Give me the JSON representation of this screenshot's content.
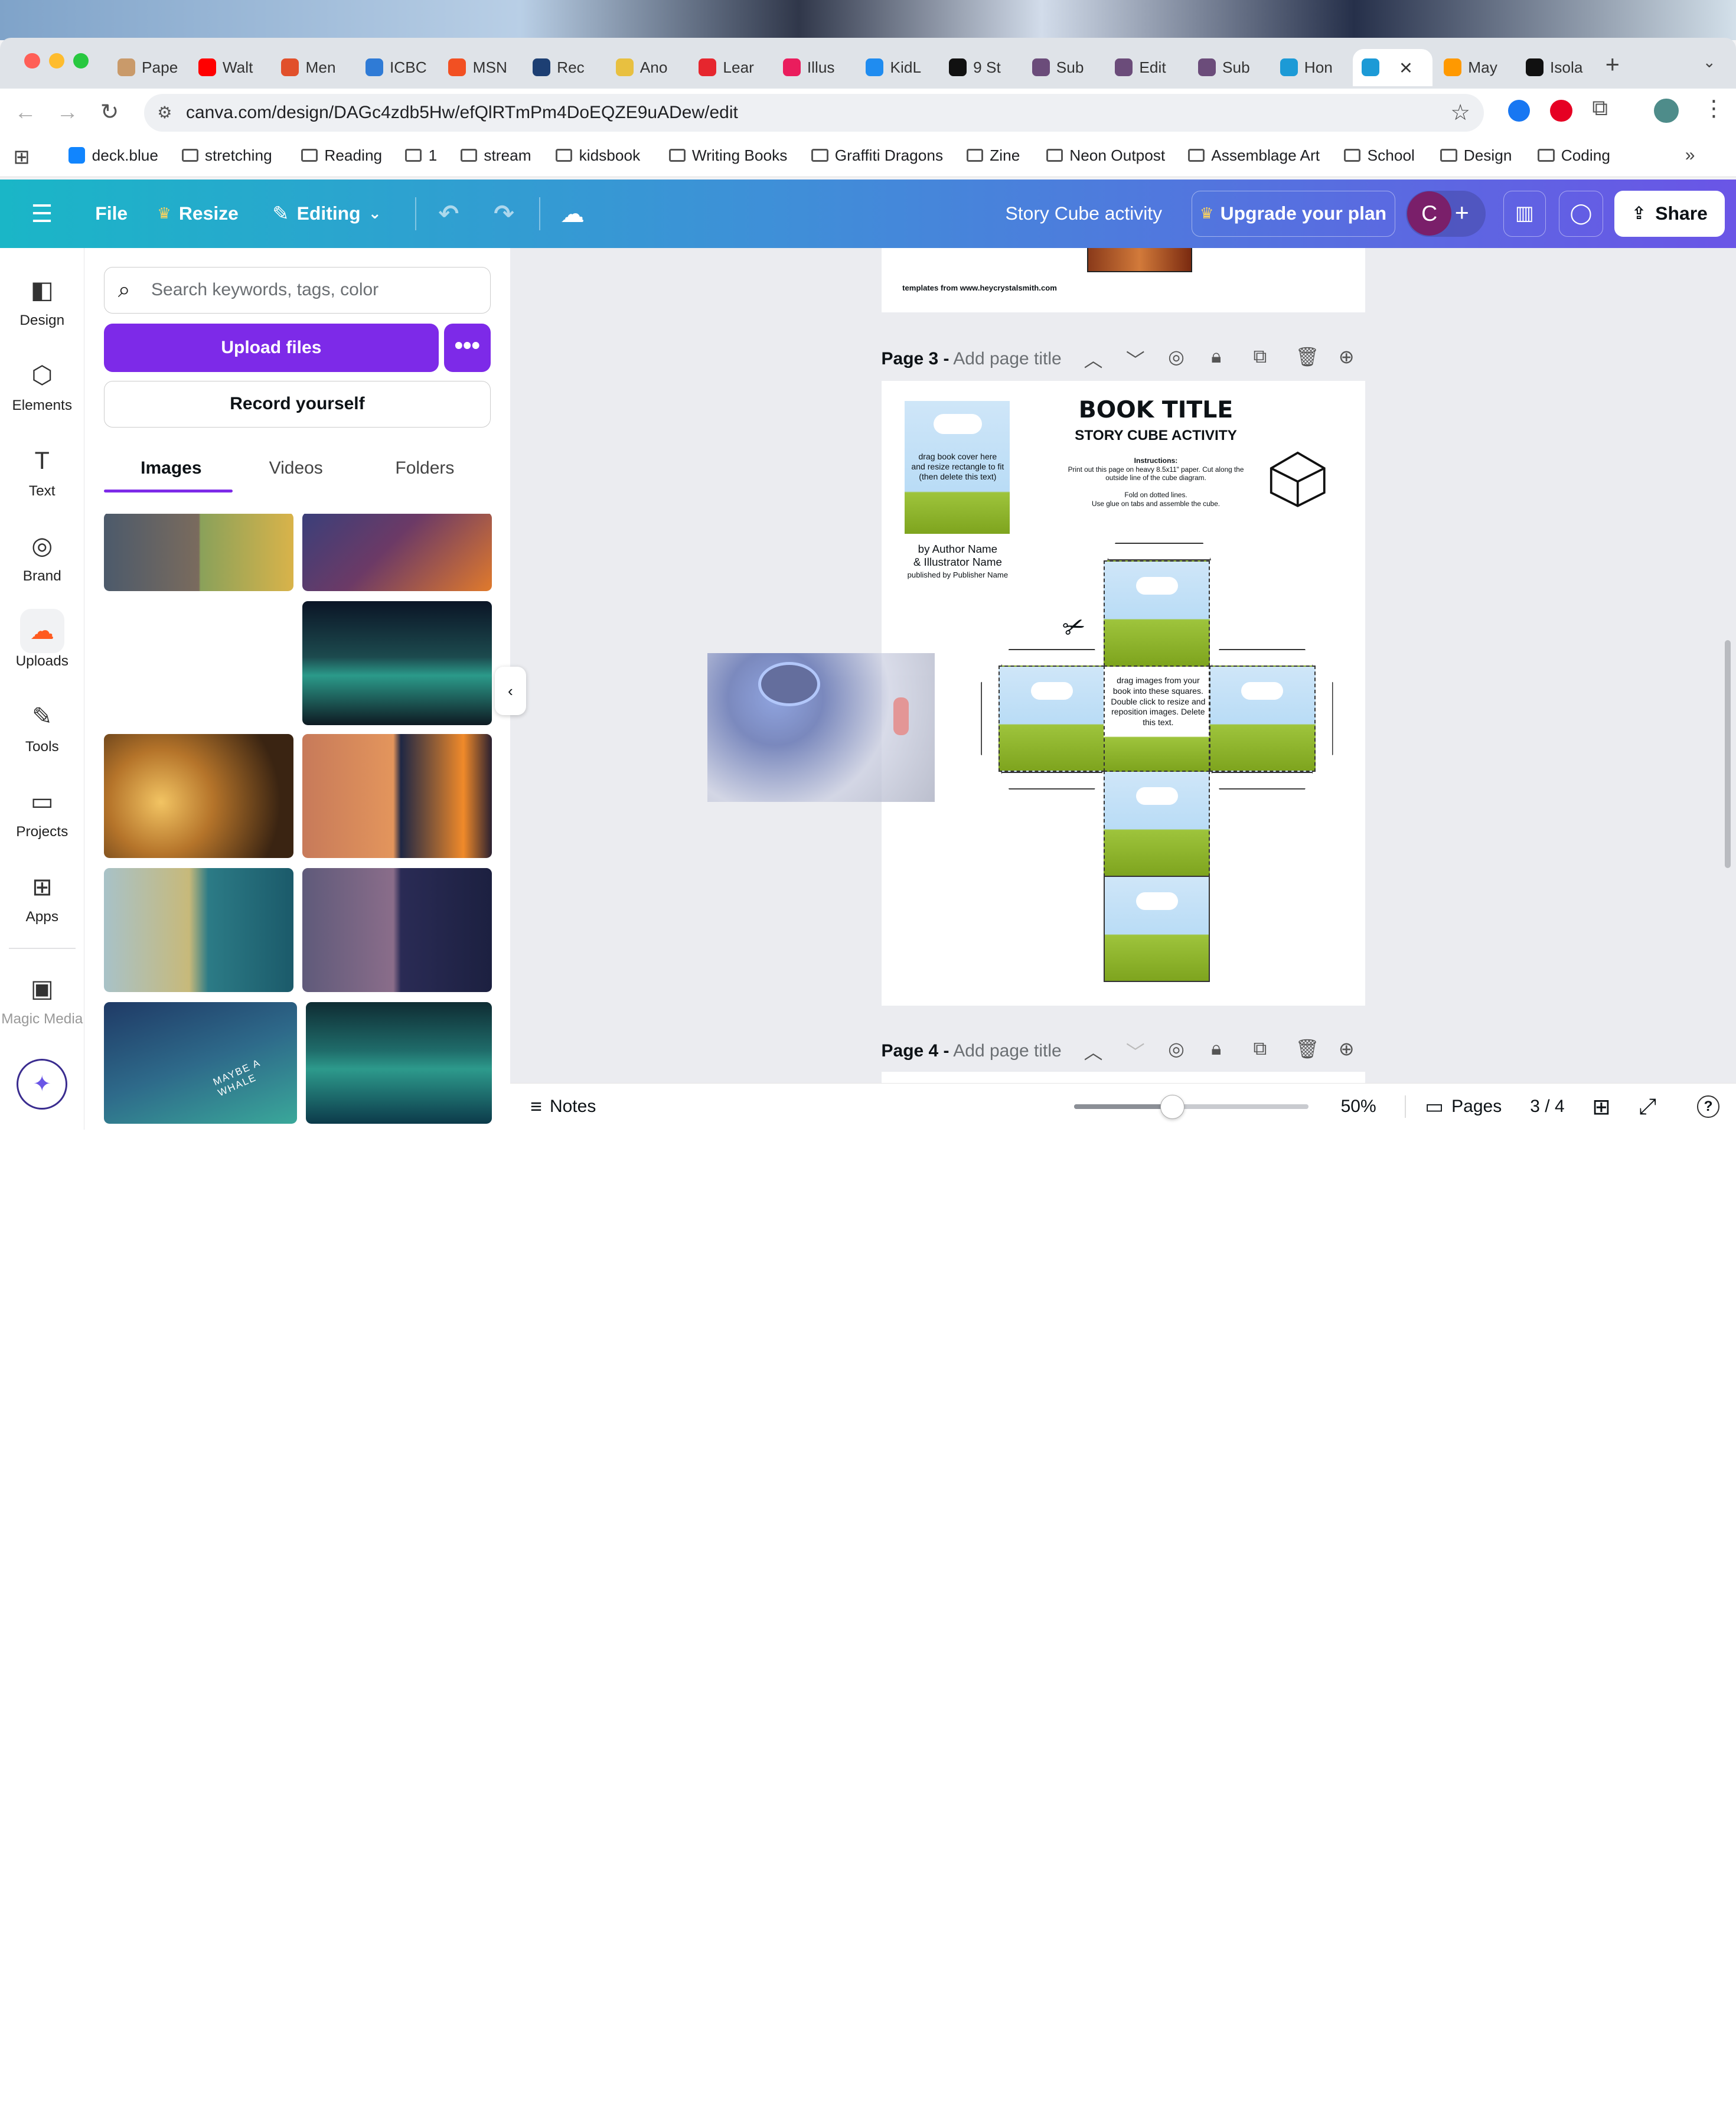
{
  "browser": {
    "tabs": [
      {
        "label": "Pape",
        "color": "#c99a6a"
      },
      {
        "label": "Walt",
        "color": "#ff0000"
      },
      {
        "label": "Men",
        "color": "#e1502b"
      },
      {
        "label": "ICBC",
        "color": "#2f7bd6"
      },
      {
        "label": "MSN",
        "color": "#f25022"
      },
      {
        "label": "Rec",
        "color": "#1d3f73"
      },
      {
        "label": "Ano",
        "color": "#e8c040"
      },
      {
        "label": "Lear",
        "color": "#e6262e"
      },
      {
        "label": "Illus",
        "color": "#ea1d5d"
      },
      {
        "label": "KidL",
        "color": "#1f8cf0"
      },
      {
        "label": "9 St",
        "color": "#111111"
      },
      {
        "label": "Sub",
        "color": "#6b4c7a"
      },
      {
        "label": "Edit",
        "color": "#6b4c7a"
      },
      {
        "label": "Sub",
        "color": "#6b4c7a"
      },
      {
        "label": "Hon",
        "color": "#1c9ad6"
      },
      {
        "label": "",
        "color": "#1c9ad6"
      },
      {
        "label": "May",
        "color": "#ff9900"
      },
      {
        "label": "Isola",
        "color": "#111111"
      }
    ],
    "active_tab_index": 15,
    "url": "canva.com/design/DAGc4zdb5Hw/efQlRTmPm4DoEQZE9uADew/edit",
    "bookmarks": [
      "deck.blue",
      "stretching",
      "Reading",
      "1",
      "stream",
      "kidsbook",
      "Writing Books",
      "Graffiti Dragons",
      "Zine",
      "Neon Outpost",
      "Assemblage Art",
      "School",
      "Design",
      "Coding"
    ],
    "more_bookmarks": "»"
  },
  "header": {
    "file": "File",
    "resize": "Resize",
    "editing": "Editing",
    "doc_title": "Story Cube activity",
    "upgrade": "Upgrade your plan",
    "avatar": "C",
    "share": "Share",
    "brand_gradient": [
      "#1ab6c7",
      "#6a55e6"
    ]
  },
  "rail": [
    "Design",
    "Elements",
    "Text",
    "Brand",
    "Uploads",
    "Tools",
    "Projects",
    "Apps",
    "Magic Media"
  ],
  "panel": {
    "search_placeholder": "Search keywords, tags, color",
    "upload_button": "Upload files",
    "more": "•••",
    "record": "Record yourself",
    "tabs": [
      "Images",
      "Videos",
      "Folders"
    ],
    "active_tab": "Images",
    "accent": "#7d2ae8",
    "maybe_a_whale": "MAYBE A WHALE"
  },
  "canvas": {
    "top_page_footer": "templates from www.heycrystalsmith.com",
    "page3": {
      "label": "Page 3 -",
      "title_placeholder": "Add page title",
      "cover_text": "drag book cover here and resize rectangle to fit (then delete this text)",
      "by_author": "by Author Name",
      "illustrator": "& Illustrator Name",
      "publisher": "published by Publisher Name",
      "book_title": "BOOK TITLE",
      "subtitle": "STORY CUBE ACTIVITY",
      "instructions_heading": "Instructions:",
      "instructions_1": "Print out this page on heavy 8.5x11\" paper. Cut along the outside line of the cube diagram.",
      "instructions_2": "Fold on dotted lines.",
      "instructions_3": "Use glue on tabs and assemble the cube.",
      "center_text": "drag images from your book into these squares. Double click to resize and reposition images. Delete this text.",
      "scissors": "✂"
    },
    "page4": {
      "label": "Page 4 -",
      "title_placeholder": "Add page title"
    }
  },
  "status": {
    "notes": "Notes",
    "zoom": "50%",
    "zoom_fraction": 0.42,
    "pages": "Pages",
    "page_count": "3 / 4",
    "help": "?"
  }
}
